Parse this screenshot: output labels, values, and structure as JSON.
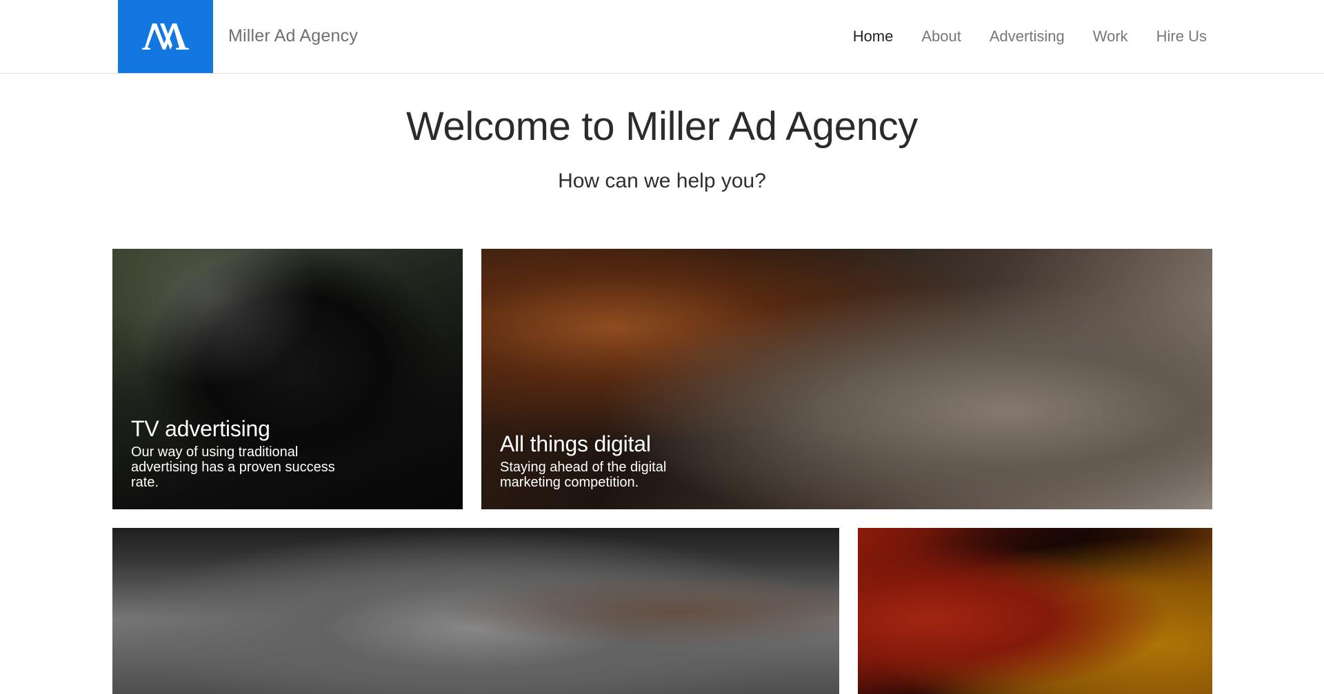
{
  "brand": {
    "logo_text": "M",
    "name": "Miller Ad Agency",
    "accent_color": "#1277e1"
  },
  "nav": {
    "items": [
      {
        "label": "Home",
        "active": true
      },
      {
        "label": "About"
      },
      {
        "label": "Advertising"
      },
      {
        "label": "Work"
      },
      {
        "label": "Hire Us"
      }
    ]
  },
  "hero": {
    "title": "Welcome to Miller Ad Agency",
    "subtitle": "How can we help you?"
  },
  "tiles": [
    {
      "title": "TV advertising",
      "description": "Our way of using traditional advertising has a proven success rate.",
      "image": "film-camera-photo"
    },
    {
      "title": "All things digital",
      "description": "Staying ahead of the digital marketing competition.",
      "image": "laptop-drawing-tablet-photo"
    },
    {
      "title": "",
      "description": "",
      "image": "desk-touchscreen-photo"
    },
    {
      "title": "",
      "description": "",
      "image": "red-orange-abstract-photo"
    }
  ]
}
